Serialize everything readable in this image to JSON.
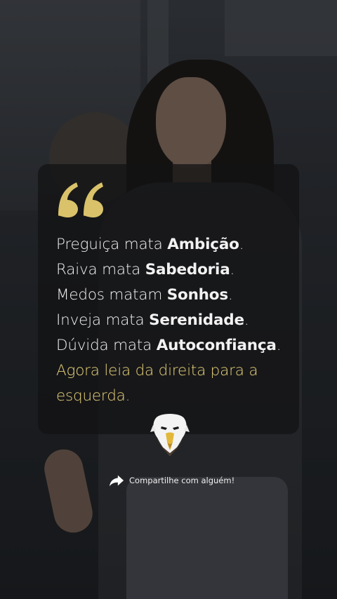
{
  "quote": {
    "lines": [
      {
        "pre": "Preguiça mata ",
        "bold": "Ambição",
        "post": "."
      },
      {
        "pre": "Raiva mata ",
        "bold": "Sabedoria",
        "post": "."
      },
      {
        "pre": "Medos matam ",
        "bold": "Sonhos",
        "post": "."
      },
      {
        "pre": "Inveja mata ",
        "bold": "Serenidade",
        "post": "."
      },
      {
        "pre": "Dúvida mata ",
        "bold": "Autoconfiança",
        "post": "."
      }
    ],
    "accent_text": "Agora leia da direita para a esquerda."
  },
  "share": {
    "label": "Compartilhe com alguém!",
    "icon": "share-arrow-icon"
  },
  "logo": {
    "icon": "eagle-logo-icon"
  },
  "colors": {
    "accent": "#e7d27a",
    "quote_mark": "#d9c26a",
    "text": "#f2f2f2",
    "card_bg": "rgba(18,18,20,0.72)"
  }
}
